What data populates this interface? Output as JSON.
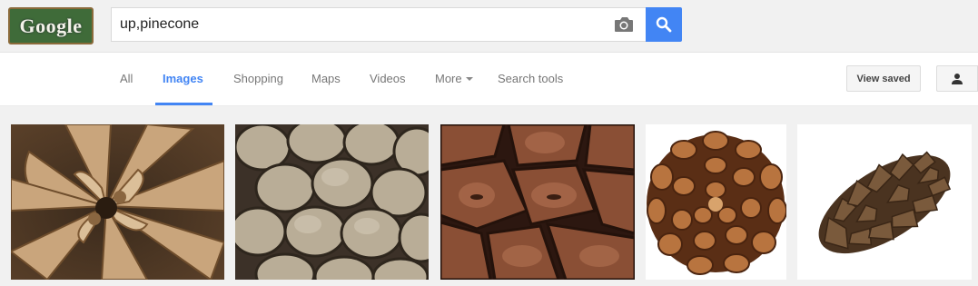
{
  "header": {
    "logo_text": "Google",
    "search_value": "up,pinecone",
    "camera_icon": "camera-icon",
    "search_icon": "magnifier-icon"
  },
  "nav": {
    "tabs": [
      "All",
      "Images",
      "Shopping",
      "Maps",
      "Videos",
      "More",
      "Search tools"
    ],
    "active_tab": "Images",
    "view_saved": "View saved",
    "account_icon": "person-icon"
  },
  "colors": {
    "accent": "#4285f4",
    "page_bg": "#f1f1f1"
  },
  "results": [
    {
      "subject": "pinecone scales close-up"
    },
    {
      "subject": "grey pinecone texture"
    },
    {
      "subject": "reddish pinecone scales"
    },
    {
      "subject": "pinecone bottom view"
    },
    {
      "subject": "brown pinecone on white"
    }
  ]
}
